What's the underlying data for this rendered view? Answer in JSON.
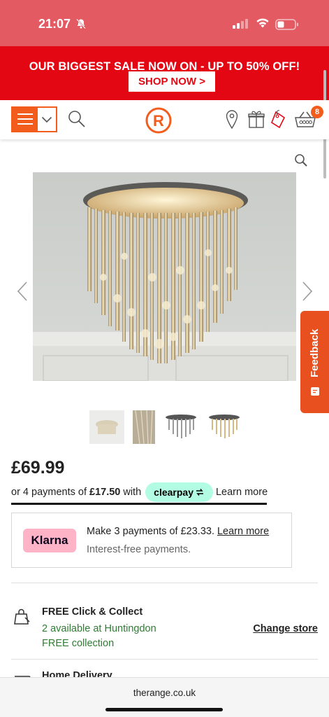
{
  "status": {
    "time": "21:07"
  },
  "promo": {
    "text": "OUR BIGGEST SALE NOW ON - UP TO 50% OFF!",
    "button": "SHOP NOW >"
  },
  "header": {
    "basket_count": "8",
    "logo_letter": "R"
  },
  "product": {
    "price": "£69.99",
    "clearpay": {
      "prefix": "or 4 payments of",
      "amount": "£17.50",
      "with": "with",
      "brand": "clearpay",
      "learn_more": "Learn more"
    },
    "klarna": {
      "brand": "Klarna",
      "main": "Make 3 payments of £23.33.",
      "learn_more": "Learn more",
      "sub": "Interest-free payments."
    }
  },
  "fulfilment": {
    "collect_title": "FREE Click & Collect",
    "collect_availability": "2 available at Huntingdon",
    "collect_free": "FREE collection",
    "change_store": "Change store",
    "delivery_title": "Home Delivery"
  },
  "feedback": {
    "label": "Feedback"
  },
  "browser": {
    "url": "therange.co.uk"
  },
  "colors": {
    "brand_orange": "#f25c1d",
    "promo_red": "#e30613",
    "status_pink": "#e35a62",
    "clearpay_mint": "#b2fce4",
    "klarna_pink": "#ffb3c7",
    "green": "#2e7d32"
  }
}
